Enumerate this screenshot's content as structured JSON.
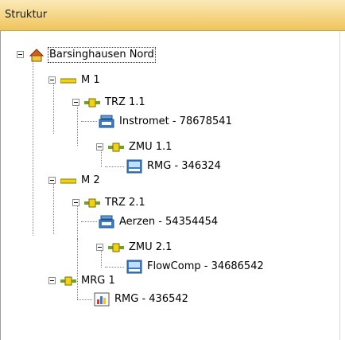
{
  "panel": {
    "title": "Struktur"
  },
  "tree": [
    {
      "id": "root",
      "label": "Barsinghausen Nord",
      "icon": "house-icon",
      "selected": true
    },
    {
      "id": "m1",
      "label": "M 1",
      "icon": "yellow-bar-icon"
    },
    {
      "id": "trz11",
      "label": "TRZ 1.1",
      "icon": "pipe-module-icon"
    },
    {
      "id": "instromet",
      "label": "Instromet - 78678541",
      "icon": "gas-meter-icon"
    },
    {
      "id": "zmu11",
      "label": "ZMU 1.1",
      "icon": "pipe-module-icon"
    },
    {
      "id": "rmg1",
      "label": "RMG - 346324",
      "icon": "computer-icon"
    },
    {
      "id": "m2",
      "label": "M 2",
      "icon": "yellow-bar-icon"
    },
    {
      "id": "trz21",
      "label": "TRZ 2.1",
      "icon": "pipe-module-icon"
    },
    {
      "id": "aerzen",
      "label": "Aerzen - 54354454",
      "icon": "gas-meter-icon"
    },
    {
      "id": "zmu21",
      "label": "ZMU 2.1",
      "icon": "pipe-module-icon"
    },
    {
      "id": "flowcomp",
      "label": "FlowComp - 34686542",
      "icon": "computer-icon"
    },
    {
      "id": "mrg1",
      "label": "MRG 1",
      "icon": "pipe-module-icon"
    },
    {
      "id": "rmg2",
      "label": "RMG - 436542",
      "icon": "bar-chart-icon"
    }
  ]
}
